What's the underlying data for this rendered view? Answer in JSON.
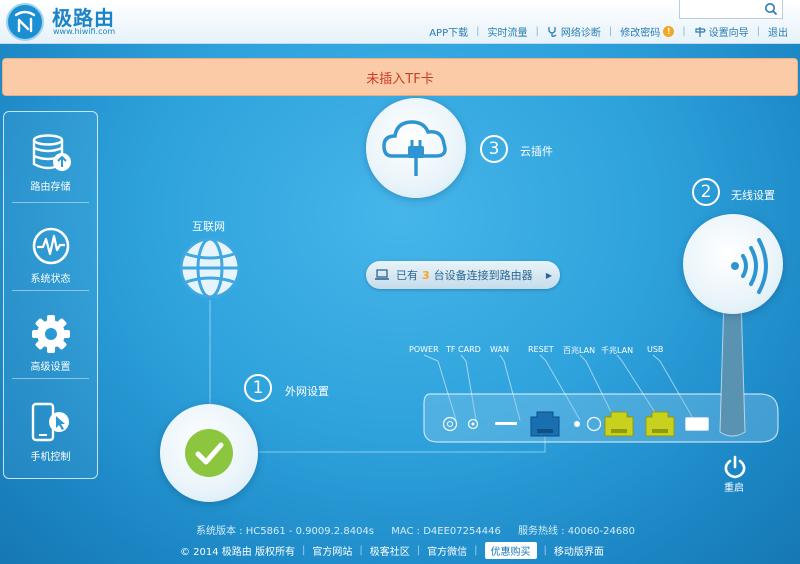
{
  "header": {
    "logo_text": "极路由",
    "logo_url": "www.hiwifi.com",
    "search_placeholder": "",
    "nav": {
      "app_download": "APP下载",
      "realtime_traffic": "实时流量",
      "net_diagnose": "网络诊断",
      "change_password": "修改密码",
      "setup_wizard": "设置向导",
      "logout": "退出"
    },
    "warn_badge": "!"
  },
  "alert": {
    "text": "未插入TF卡"
  },
  "sidebar": {
    "items": [
      {
        "label": "路由存储",
        "icon": "storage-icon"
      },
      {
        "label": "系统状态",
        "icon": "pulse-icon"
      },
      {
        "label": "高级设置",
        "icon": "gear-icon"
      },
      {
        "label": "手机控制",
        "icon": "phone-icon"
      }
    ]
  },
  "diagram": {
    "internet_label": "互联网",
    "cloud": {
      "number": "3",
      "label": "云插件"
    },
    "wireless": {
      "number": "2",
      "label": "无线设置"
    },
    "wan": {
      "number": "1",
      "label": "外网设置"
    },
    "connected": {
      "prefix": "已有",
      "count": "3",
      "suffix": "台设备连接到路由器",
      "arrow": "▶"
    },
    "ports": [
      "POWER",
      "TF CARD",
      "WAN",
      "RESET",
      "百兆LAN",
      "千兆LAN",
      "USB"
    ],
    "reboot_label": "重启"
  },
  "footer": {
    "version": "系统版本 : HC5861 - 0.9009.2.8404s",
    "mac": "MAC : D4EE07254446",
    "hotline": "服务热线 : 40060-24680",
    "copyright": "© 2014 极路由 版权所有",
    "links": {
      "official_site": "官方网站",
      "community": "极客社区",
      "wechat": "官方微信",
      "buy": "优惠购买",
      "mobile": "移动版界面"
    }
  },
  "colors": {
    "accent": "#1c84c6",
    "alert_bg": "#fbcaa6",
    "alert_text": "#c8402a",
    "ok_green": "#8cc63f",
    "port_yellow": "#c8d21e",
    "port_blue": "#1a6fb0"
  }
}
